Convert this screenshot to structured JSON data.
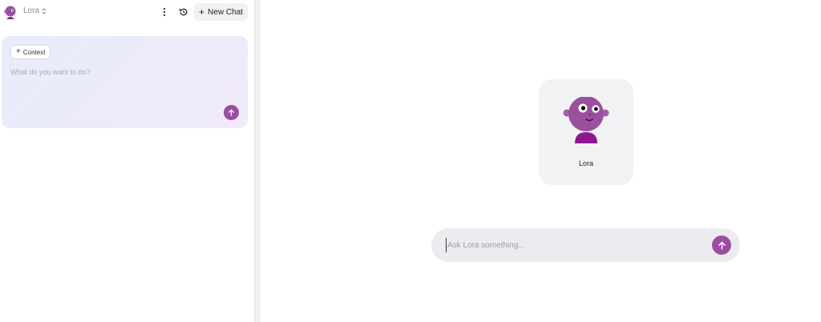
{
  "sidebar": {
    "agent": {
      "name": "Lora"
    },
    "new_chat_label": "New Chat",
    "composer": {
      "context_label": "Context",
      "placeholder": "What do you want to do?"
    }
  },
  "main": {
    "agent_card": {
      "name": "Lora"
    },
    "ask_placeholder": "Ask Lora something..."
  },
  "colors": {
    "accent": "#9a4ea0",
    "avatar_face": "#9b4f9f",
    "avatar_shirt": "#8e1790",
    "composer_gradient_start": "#e6ecfb",
    "composer_gradient_end": "#f1eafb"
  }
}
